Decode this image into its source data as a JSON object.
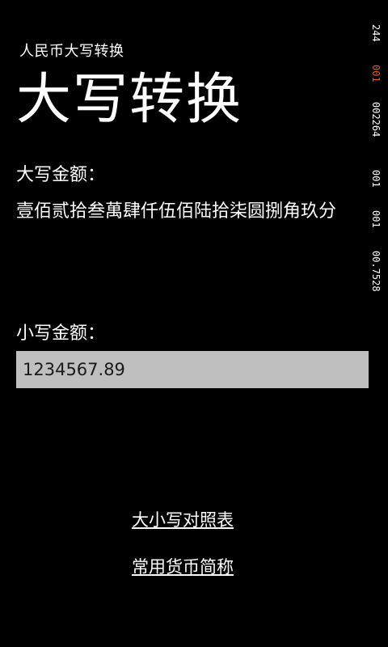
{
  "app": {
    "subtitle": "人民币大写转换",
    "title": "大写转换"
  },
  "upper": {
    "label": "大写金额：",
    "value": "壹佰贰拾叁萬肆仟伍佰陆拾柒圆捌角玖分"
  },
  "lower": {
    "label": "小写金额：",
    "input_value": "1234567.89"
  },
  "links": {
    "compare_table": "大小写对照表",
    "currency_abbr": "常用货币简称"
  },
  "status_bar": {
    "items": [
      "244",
      "001",
      "002264",
      "001",
      "001",
      "00.7528"
    ],
    "accent_color": "#e05a1e"
  }
}
